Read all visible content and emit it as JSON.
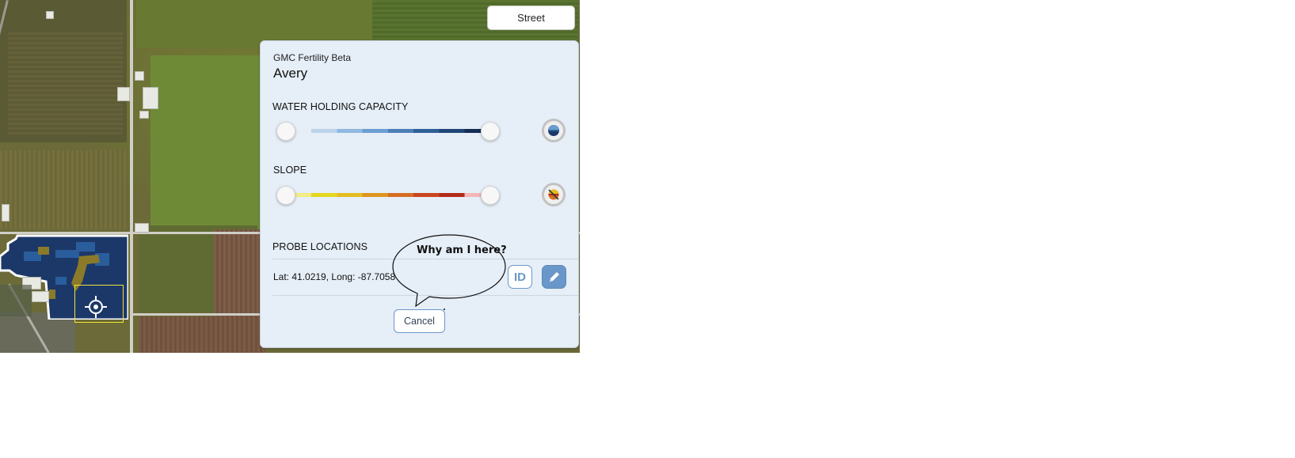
{
  "map": {
    "street_button_label": "Street",
    "soil_colors": {
      "dark": "#1c3868",
      "mid": "#2a5d9c",
      "olive": "#8b7a2a"
    },
    "crosshair_icon": "crosshair-icon"
  },
  "panel": {
    "subtitle": "GMC Fertility Beta",
    "title": "Avery",
    "water": {
      "label": "WATER HOLDING CAPACITY",
      "range": {
        "low": 0,
        "high": 1
      },
      "colors": [
        "#e8edf2",
        "#bcd3ea",
        "#8fb9e0",
        "#6a9ed0",
        "#4d7fb7",
        "#2f5f97",
        "#1f4577",
        "#132d54"
      ],
      "toggle_icon": "water-layer-icon"
    },
    "slope": {
      "label": "SLOPE",
      "range": {
        "low": 0,
        "high": 1
      },
      "colors": [
        "#f1ec84",
        "#e3d81d",
        "#e2bd20",
        "#de9520",
        "#d66d22",
        "#c9451d",
        "#b22a18",
        "#f2b6b8"
      ],
      "toggle_icon": "slope-layer-off-icon"
    },
    "probe": {
      "label": "PROBE LOCATIONS",
      "location_text": "Lat: 41.0219, Long: -87.7058",
      "id_button_label": "ID",
      "edit_icon": "pencil-icon"
    },
    "cancel_label": "Cancel"
  },
  "bubble": {
    "text": "Why am I here?"
  }
}
